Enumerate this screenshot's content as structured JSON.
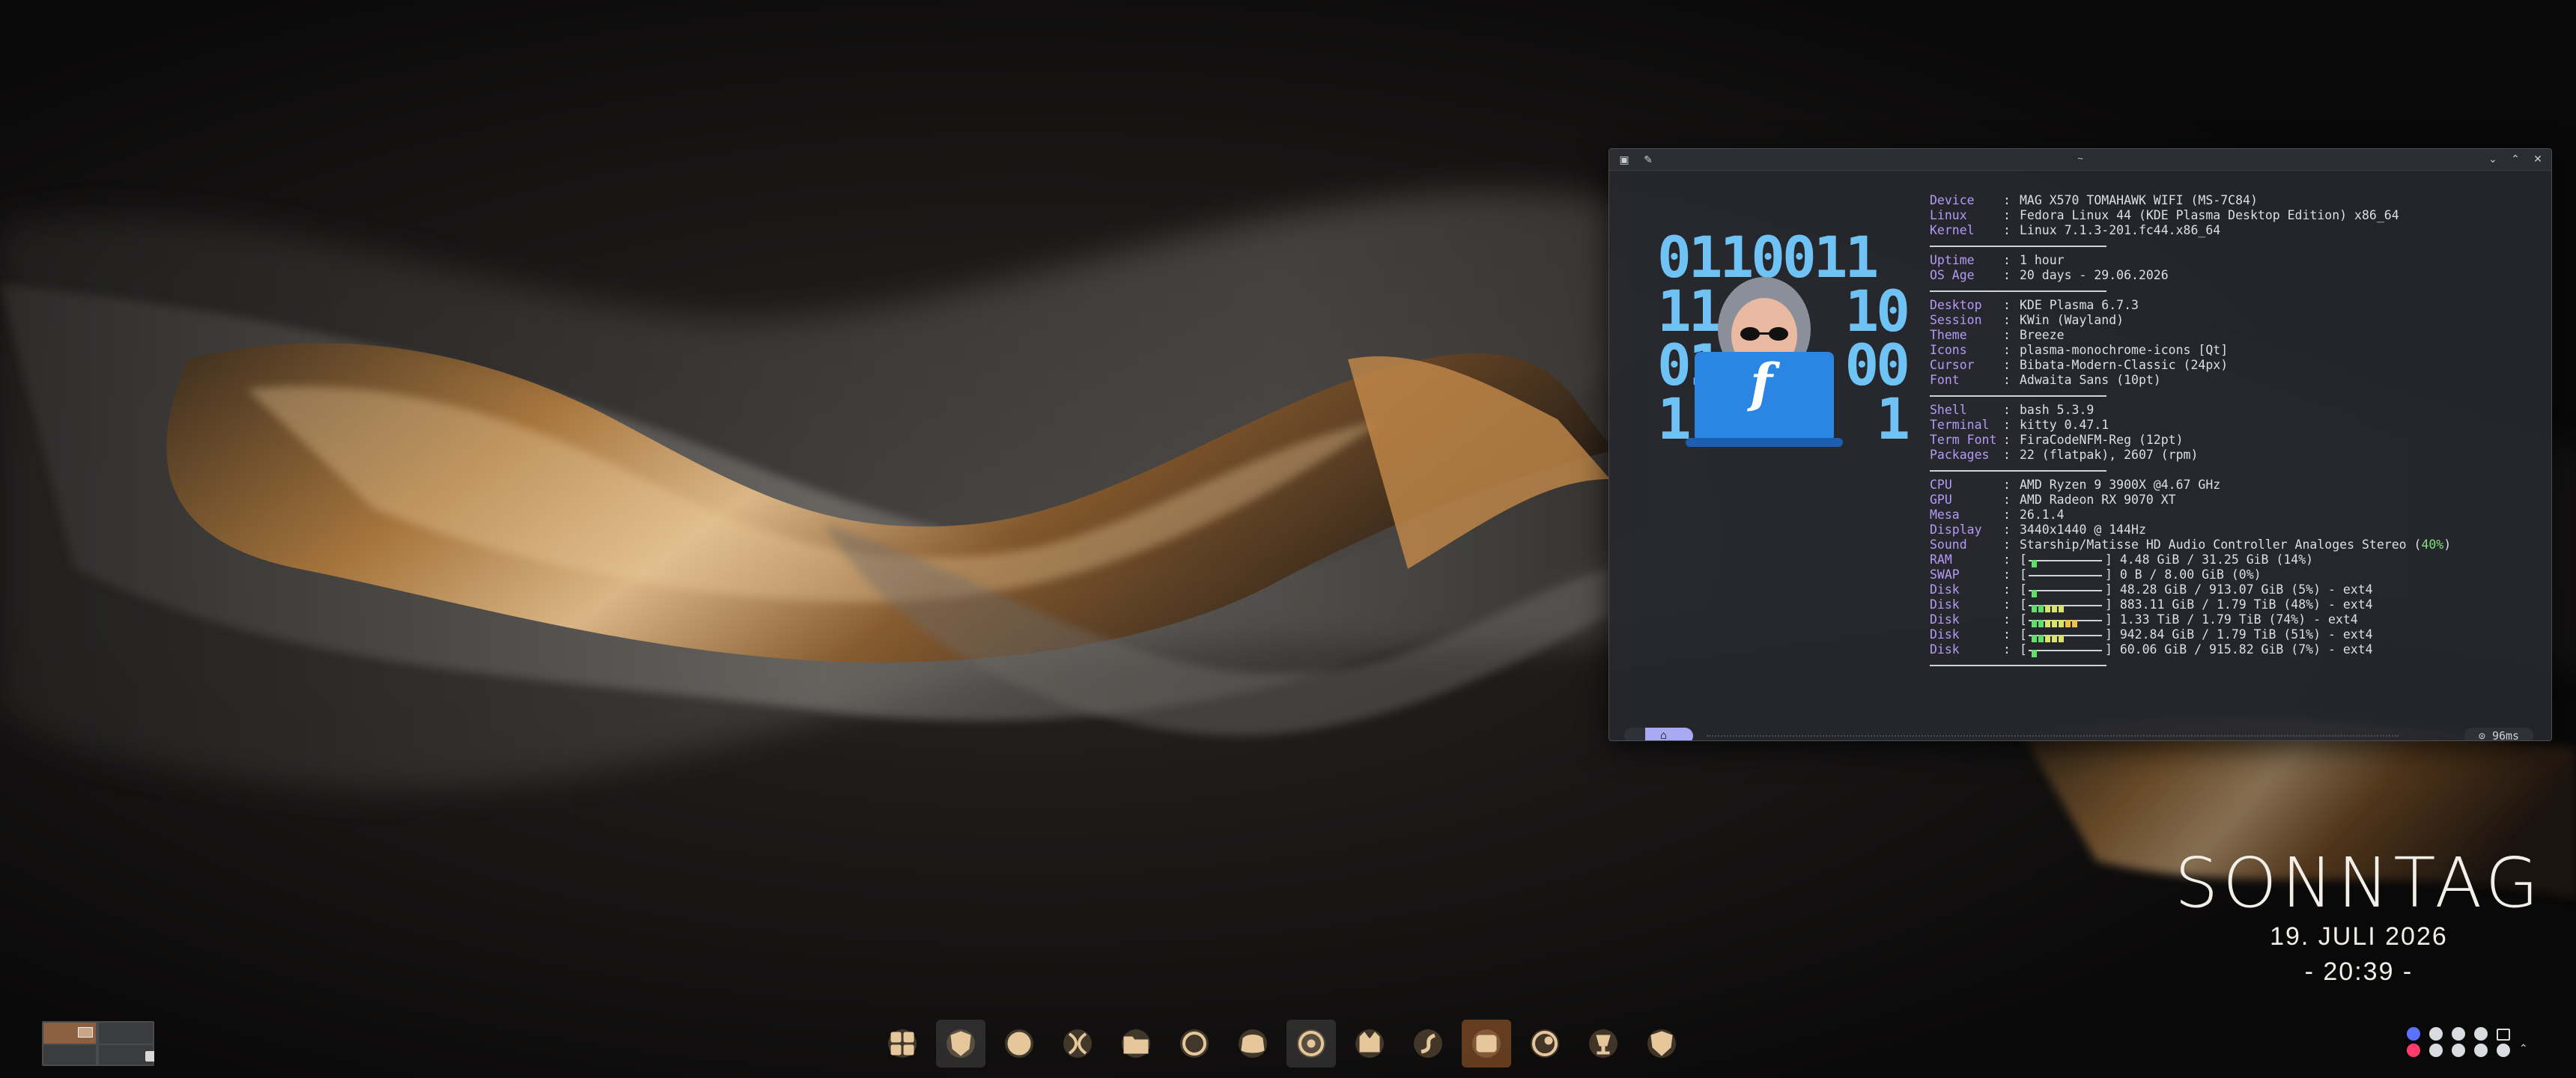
{
  "wallpaper": {
    "palette": [
      "#0b0a0a",
      "#c48a4a",
      "#e3b782",
      "#8a8683"
    ]
  },
  "terminal": {
    "title": "~",
    "titlebar_icons": [
      "pin-icon",
      "keep-above-icon"
    ],
    "window_controls": [
      "minimize-icon",
      "maximize-icon",
      "close-icon"
    ],
    "logo": {
      "binary_lines": [
        "0110011",
        "11    10",
        "01    00",
        "1      1"
      ],
      "emblem": "f"
    },
    "info": [
      {
        "k": "Device",
        "v": "MAG X570 TOMAHAWK WIFI (MS-7C84)"
      },
      {
        "k": "Linux",
        "v": "Fedora Linux 44 (KDE Plasma Desktop Edition) x86_64"
      },
      {
        "k": "Kernel",
        "v": "Linux 7.1.3-201.fc44.x86_64"
      },
      {
        "rule": true
      },
      {
        "k": "Uptime",
        "v": "1 hour"
      },
      {
        "k": "OS Age",
        "v": "20 days - 29.06.2026"
      },
      {
        "rule": true
      },
      {
        "k": "Desktop",
        "v": "KDE Plasma 6.7.3"
      },
      {
        "k": "Session",
        "v": "KWin (Wayland)"
      },
      {
        "k": "Theme",
        "v": "Breeze"
      },
      {
        "k": "Icons",
        "v": "plasma-monochrome-icons [Qt]"
      },
      {
        "k": "Cursor",
        "v": "Bibata-Modern-Classic (24px)"
      },
      {
        "k": "Font",
        "v": "Adwaita Sans (10pt)"
      },
      {
        "rule": true
      },
      {
        "k": "Shell",
        "v": "bash 5.3.9"
      },
      {
        "k": "Terminal",
        "v": "kitty 0.47.1"
      },
      {
        "k": "Term Font",
        "v": "FiraCodeNFM-Reg (12pt)"
      },
      {
        "k": "Packages",
        "v": "22 (flatpak), 2607 (rpm)"
      },
      {
        "rule": true
      },
      {
        "k": "CPU",
        "v": "AMD Ryzen 9 3900X @4.67 GHz"
      },
      {
        "k": "GPU",
        "v": "AMD Radeon RX 9070 XT"
      },
      {
        "k": "Mesa",
        "v": "26.1.4"
      },
      {
        "k": "Display",
        "v": "3440x1440 @ 144Hz"
      },
      {
        "k": "Sound",
        "v": "Starship/Matisse HD Audio Controller Analoges Stereo (",
        "hl": "40%",
        "tail": ")"
      },
      {
        "k": "RAM",
        "bar": 0.14,
        "v": "4.48 GiB / 31.25 GiB (14%)"
      },
      {
        "k": "SWAP",
        "bar": 0.0,
        "v": "0 B / 8.00 GiB (0%)"
      },
      {
        "k": "Disk",
        "bar": 0.05,
        "v": "48.28 GiB / 913.07 GiB (5%) - ext4"
      },
      {
        "k": "Disk",
        "bar": 0.48,
        "v": "883.11 GiB / 1.79 TiB (48%) - ext4"
      },
      {
        "k": "Disk",
        "bar": 0.74,
        "v": "1.33 TiB / 1.79 TiB (74%) - ext4"
      },
      {
        "k": "Disk",
        "bar": 0.51,
        "v": "942.84 GiB / 1.79 TiB (51%) - ext4"
      },
      {
        "k": "Disk",
        "bar": 0.07,
        "v": "60.06 GiB / 915.82 GiB (7%) - ext4"
      },
      {
        "rule": true
      }
    ],
    "prompt": {
      "dir_icon": "home-icon",
      "duration": "⊙ 96ms",
      "cursor": "→ ▏"
    }
  },
  "clock": {
    "day": "SONNTAG",
    "date": "19. JULI 2026",
    "time": "- 20:39 -"
  },
  "dock": {
    "items": [
      {
        "name": "app-launcher-icon",
        "state": ""
      },
      {
        "name": "brave-browser-icon",
        "state": "active"
      },
      {
        "name": "firefox-icon",
        "state": ""
      },
      {
        "name": "kde-connect-icon",
        "state": ""
      },
      {
        "name": "file-manager-icon",
        "state": ""
      },
      {
        "name": "browser-globe-icon",
        "state": ""
      },
      {
        "name": "discord-icon",
        "state": ""
      },
      {
        "name": "audio-player-icon",
        "state": "active"
      },
      {
        "name": "kitty-terminal-icon",
        "state": ""
      },
      {
        "name": "editor-icon",
        "state": ""
      },
      {
        "name": "game-launcher-icon",
        "state": "sel"
      },
      {
        "name": "steam-icon",
        "state": ""
      },
      {
        "name": "wine-icon",
        "state": ""
      },
      {
        "name": "security-shield-icon",
        "state": ""
      }
    ]
  }
}
